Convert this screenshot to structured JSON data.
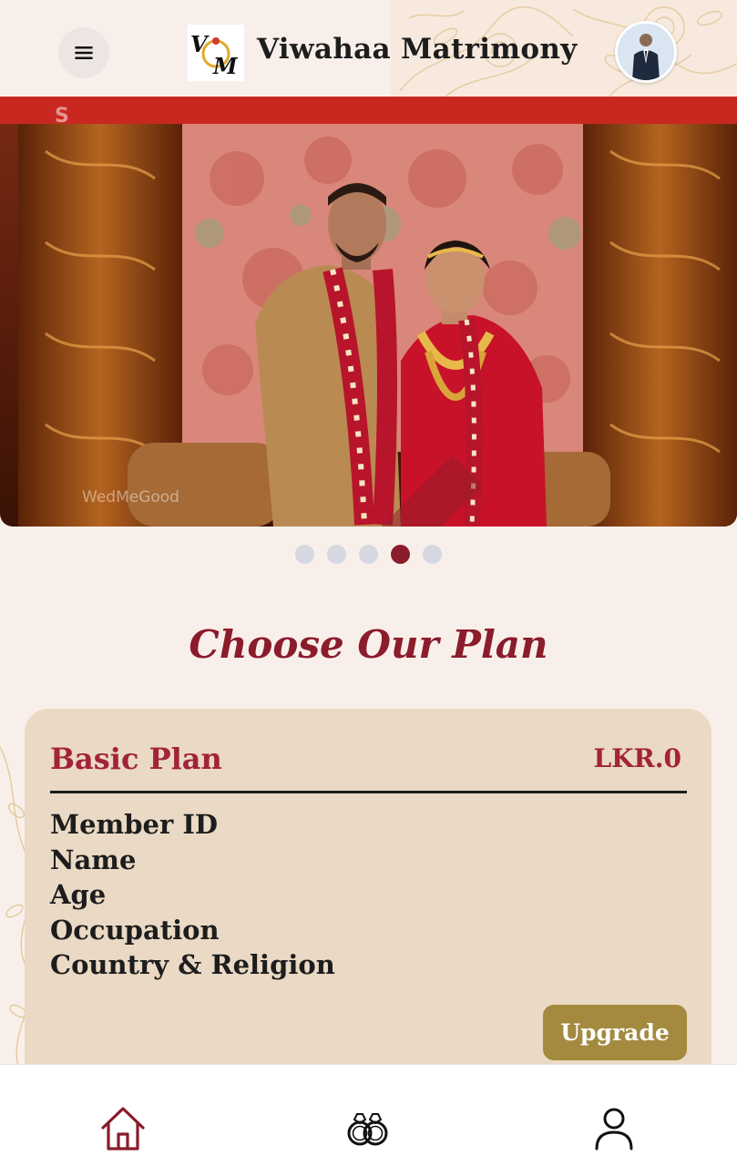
{
  "header": {
    "app_title": "Viwahaa Matrimony",
    "logo_text": "VM",
    "menu_icon": "hamburger-menu-icon",
    "avatar_icon": "profile-avatar"
  },
  "banner": {
    "watermark": "WedMeGood",
    "slide_count": 5,
    "active_slide": 4
  },
  "plans": {
    "section_title": "Choose Our Plan",
    "items": [
      {
        "name": "Basic Plan",
        "price": "LKR.0",
        "features": [
          "Member ID",
          "Name",
          "Age",
          "Occupation",
          "Country & Religion"
        ],
        "button_label": "Upgrade"
      }
    ]
  },
  "bottom_nav": {
    "items": [
      {
        "icon": "home-icon",
        "active": true
      },
      {
        "icon": "rings-icon",
        "active": false
      },
      {
        "icon": "user-icon",
        "active": false
      }
    ]
  },
  "colors": {
    "background": "#f9efea",
    "brand_maroon": "#8a1c2b",
    "card_beige": "#ead9c4",
    "button_gold": "#a38a3f"
  }
}
